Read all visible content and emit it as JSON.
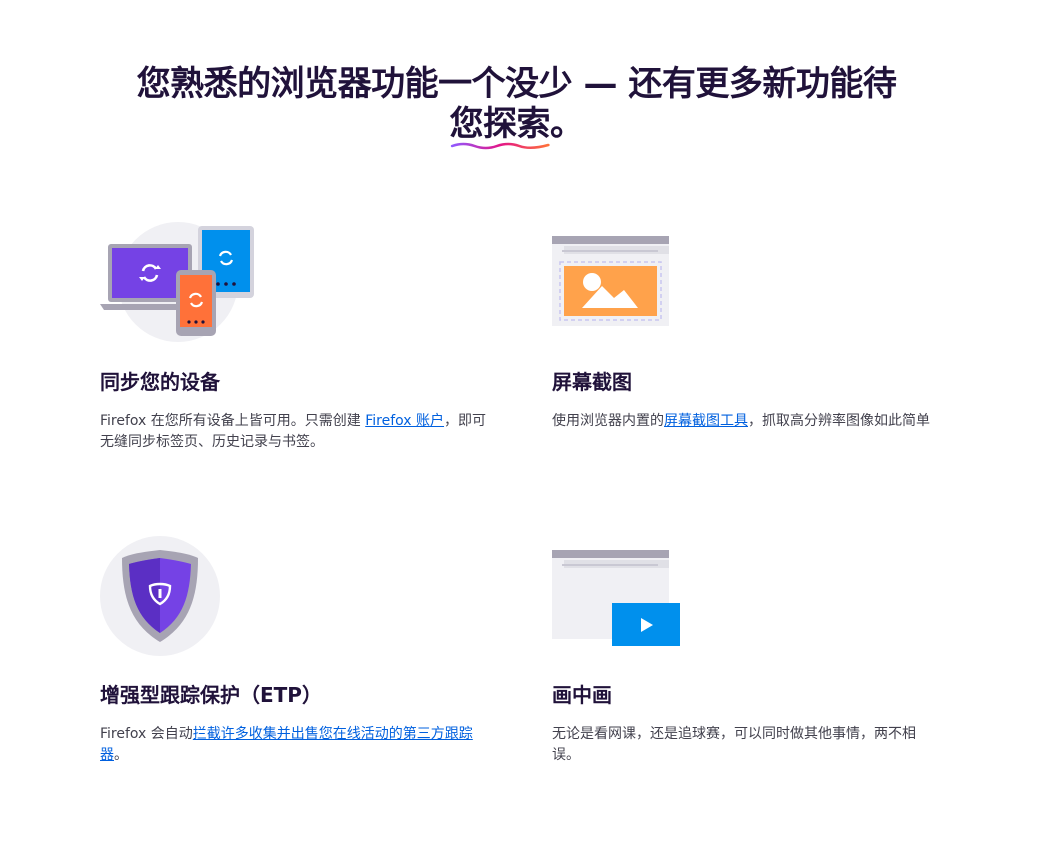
{
  "headline": {
    "text_before": "您熟悉的浏览器功能一个没少 — 还有更多新功能待",
    "text_highlight": "您探索",
    "text_after": "。"
  },
  "features": {
    "sync": {
      "title": "同步您的设备",
      "desc_before": "Firefox 在您所有设备上皆可用。只需创建 ",
      "link": "Firefox 账户",
      "desc_after": "，即可无缝同步标签页、历史记录与书签。"
    },
    "screenshot": {
      "title": "屏幕截图",
      "desc_before": "使用浏览器内置的",
      "link": "屏幕截图工具",
      "desc_after": "，抓取高分辨率图像如此简单"
    },
    "etp": {
      "title": "增强型跟踪保护（ETP）",
      "desc_before": "Firefox 会自动",
      "link": "拦截许多收集并出售您在线活动的第三方跟踪器",
      "desc_after": "。"
    },
    "pip": {
      "title": "画中画",
      "desc": "无论是看网课，还是追球赛，可以同时做其他事情，两不相误。"
    }
  },
  "colors": {
    "heading": "#20123a",
    "body": "#42414d",
    "link": "#0060df",
    "purple": "#7542e5",
    "blue": "#0090ed",
    "orange": "#ff7139"
  },
  "icons": [
    "sync-devices-illustration",
    "screenshot-illustration",
    "shield-icon",
    "picture-in-picture-illustration",
    "play-icon"
  ]
}
